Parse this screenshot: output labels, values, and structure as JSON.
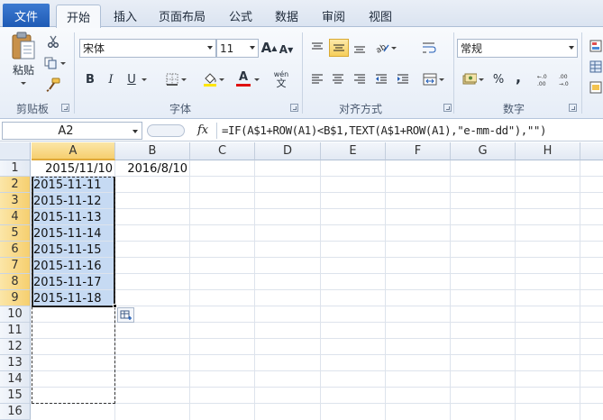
{
  "tabs": {
    "file": "文件",
    "items": [
      "开始",
      "插入",
      "页面布局",
      "公式",
      "数据",
      "审阅",
      "视图"
    ],
    "active": "开始"
  },
  "ribbon": {
    "clipboard": {
      "paste": "粘贴",
      "group_label": "剪贴板"
    },
    "font": {
      "font_name": "宋体",
      "font_size": "11",
      "bold": "B",
      "italic": "I",
      "underline": "U",
      "grow": "A",
      "shrink": "A",
      "color_letter": "A",
      "phonetic": "wén",
      "group_label": "字体"
    },
    "alignment": {
      "group_label": "对齐方式"
    },
    "number": {
      "format": "常规",
      "percent": "%",
      "comma": ",",
      "group_label": "数字"
    }
  },
  "formula_bar": {
    "name_box": "A2",
    "fx": "fx",
    "formula": "=IF(A$1+ROW(A1)<B$1,TEXT(A$1+ROW(A1),\"e-mm-dd\"),\"\")"
  },
  "sheet": {
    "columns": [
      "A",
      "B",
      "C",
      "D",
      "E",
      "F",
      "G",
      "H"
    ],
    "selected_column": "A",
    "rows": [
      "1",
      "2",
      "3",
      "4",
      "5",
      "6",
      "7",
      "8",
      "9",
      "10",
      "11",
      "12",
      "13",
      "14",
      "15",
      "16"
    ],
    "row1": {
      "a": "2015/11/10",
      "b": "2016/8/10"
    },
    "column_a_values": [
      "2015-11-11",
      "2015-11-12",
      "2015-11-13",
      "2015-11-14",
      "2015-11-15",
      "2015-11-16",
      "2015-11-17",
      "2015-11-18"
    ]
  },
  "colors": {
    "accent": "#1f5bb5",
    "selection": "#c6daf3",
    "header_selected": "#f6cf6f"
  }
}
